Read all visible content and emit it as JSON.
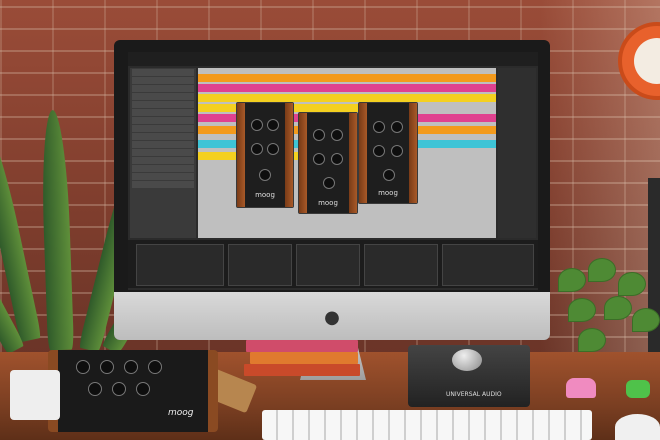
{
  "scene": {
    "description_visible_text": {
      "pedal_brand": "moog",
      "plugin_brand": "moog",
      "interface_brand": "UNIVERSAL AUDIO"
    },
    "colors": {
      "brick": "#8a4a36",
      "desk": "#a0522d",
      "clock": "#e8612c",
      "daw_orange": "#f39a1c",
      "daw_pink": "#e0418f",
      "daw_yellow": "#f4d020",
      "daw_cyan": "#3ec4d6"
    }
  }
}
